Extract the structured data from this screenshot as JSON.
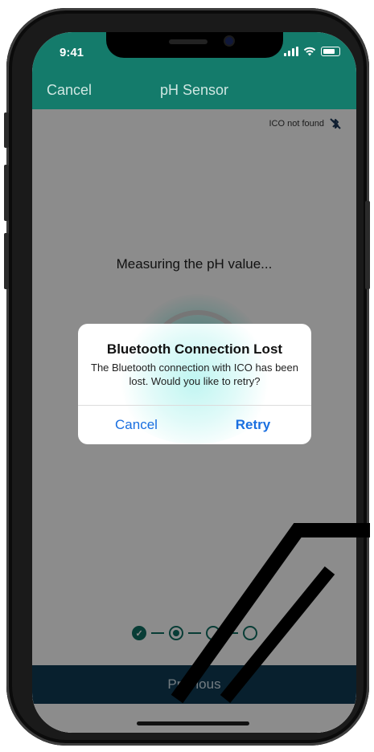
{
  "status_bar": {
    "time": "9:41",
    "icons": [
      "signal-icon",
      "wifi-icon",
      "battery-icon"
    ]
  },
  "nav": {
    "cancel_label": "Cancel",
    "title": "pH Sensor"
  },
  "connection": {
    "text": "ICO not found",
    "icon": "bluetooth-off-icon"
  },
  "measuring": {
    "text": "Measuring the pH value..."
  },
  "stepper": {
    "steps": [
      "done",
      "current",
      "upcoming",
      "upcoming"
    ]
  },
  "footer": {
    "previous_label": "Previous"
  },
  "dialog": {
    "title": "Bluetooth Connection Lost",
    "message": "The Bluetooth connection with ICO has been lost. Would you like to retry?",
    "cancel_label": "Cancel",
    "retry_label": "Retry"
  },
  "colors": {
    "teal": "#147b6b",
    "dark_navy": "#0f3b55",
    "ios_blue": "#1a6fe0"
  }
}
